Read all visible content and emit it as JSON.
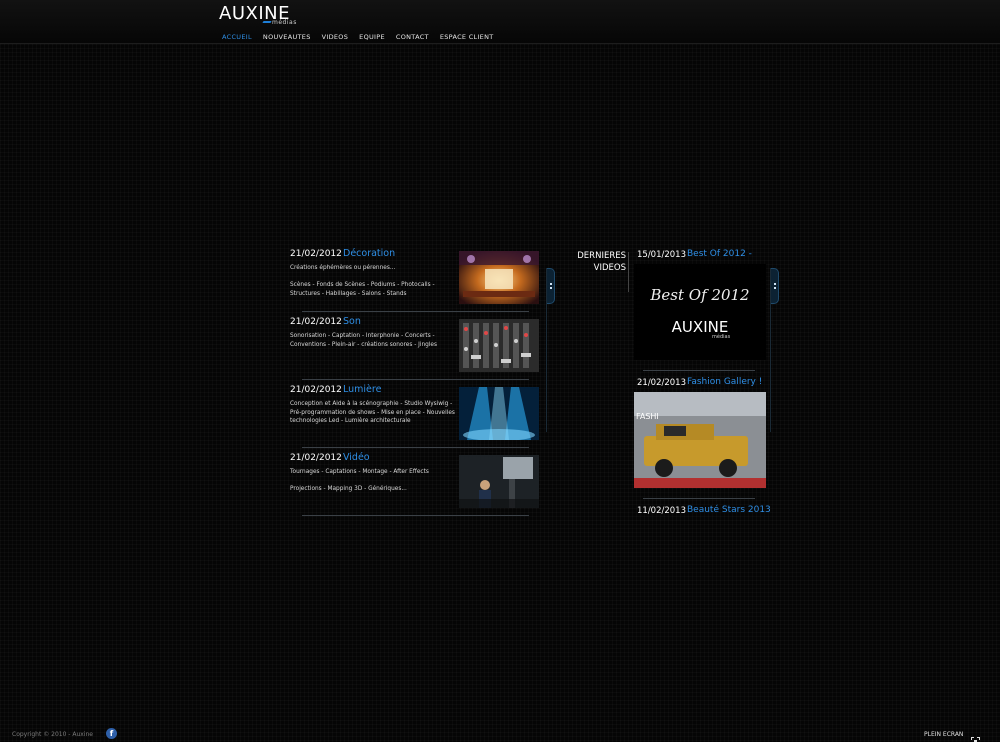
{
  "brand": {
    "name": "AUXINE",
    "sub": "médias"
  },
  "nav": [
    {
      "label": "ACCUEIL",
      "active": true
    },
    {
      "label": "NOUVEAUTES"
    },
    {
      "label": "VIDEOS"
    },
    {
      "label": "EQUIPE"
    },
    {
      "label": "CONTACT"
    },
    {
      "label": "ESPACE CLIENT"
    }
  ],
  "news": [
    {
      "date": "21/02/2012",
      "title": "Décoration",
      "desc": "Créations éphémères ou pérennes...\n\nScènes - Fonds de Scènes - Podiums - Photocalls - Structures - Habillages - Salons - Stands"
    },
    {
      "date": "21/02/2012",
      "title": "Son",
      "desc": "Sonorisation - Captation - Interphonie - Concerts - Conventions - Plein-air - créations sonores - Jingles"
    },
    {
      "date": "21/02/2012",
      "title": "Lumière",
      "desc": "Conception et Aide à la scénographie - Studio Wysiwig - Pré-programmation de shows - Mise en place - Nouvelles technologies Led - Lumière architecturale"
    },
    {
      "date": "21/02/2012",
      "title": "Vidéo",
      "desc": "Tournages - Captations - Montage - After Effects\n\nProjections - Mapping 3D - Génériques..."
    }
  ],
  "videos_section": {
    "label_line1": "DERNIERES",
    "label_line2": "VIDEOS"
  },
  "videos": [
    {
      "date": "15/01/2013",
      "title": "Best Of 2012 -",
      "thumb_text": "Best Of 2012",
      "thumb_brand": "AUXINE",
      "thumb_sub": "médias"
    },
    {
      "date": "21/02/2013",
      "title": "Fashion Gallery !",
      "thumb_text": "FASHI"
    },
    {
      "date": "11/02/2013",
      "title": "Beauté Stars 2013"
    }
  ],
  "footer": {
    "copyright": "Copyright © 2010 - Auxine",
    "facebook": "f",
    "fullscreen": "PLEIN ECRAN"
  },
  "colors": {
    "accent": "#2f8fe6",
    "background": "#050505"
  }
}
